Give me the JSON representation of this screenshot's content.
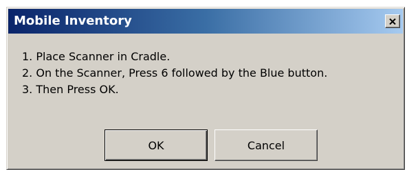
{
  "window": {
    "title": "Mobile Inventory",
    "close_icon": "close-x-icon"
  },
  "messages": [
    "1. Place Scanner in Cradle.",
    "2. On the Scanner, Press 6 followed by the Blue button.",
    "3. Then Press OK."
  ],
  "buttons": {
    "ok_label": "OK",
    "cancel_label": "Cancel"
  },
  "colors": {
    "titlebar_start": "#0a246a",
    "titlebar_end": "#a6caf0",
    "dialog_face": "#d4d0c8"
  }
}
